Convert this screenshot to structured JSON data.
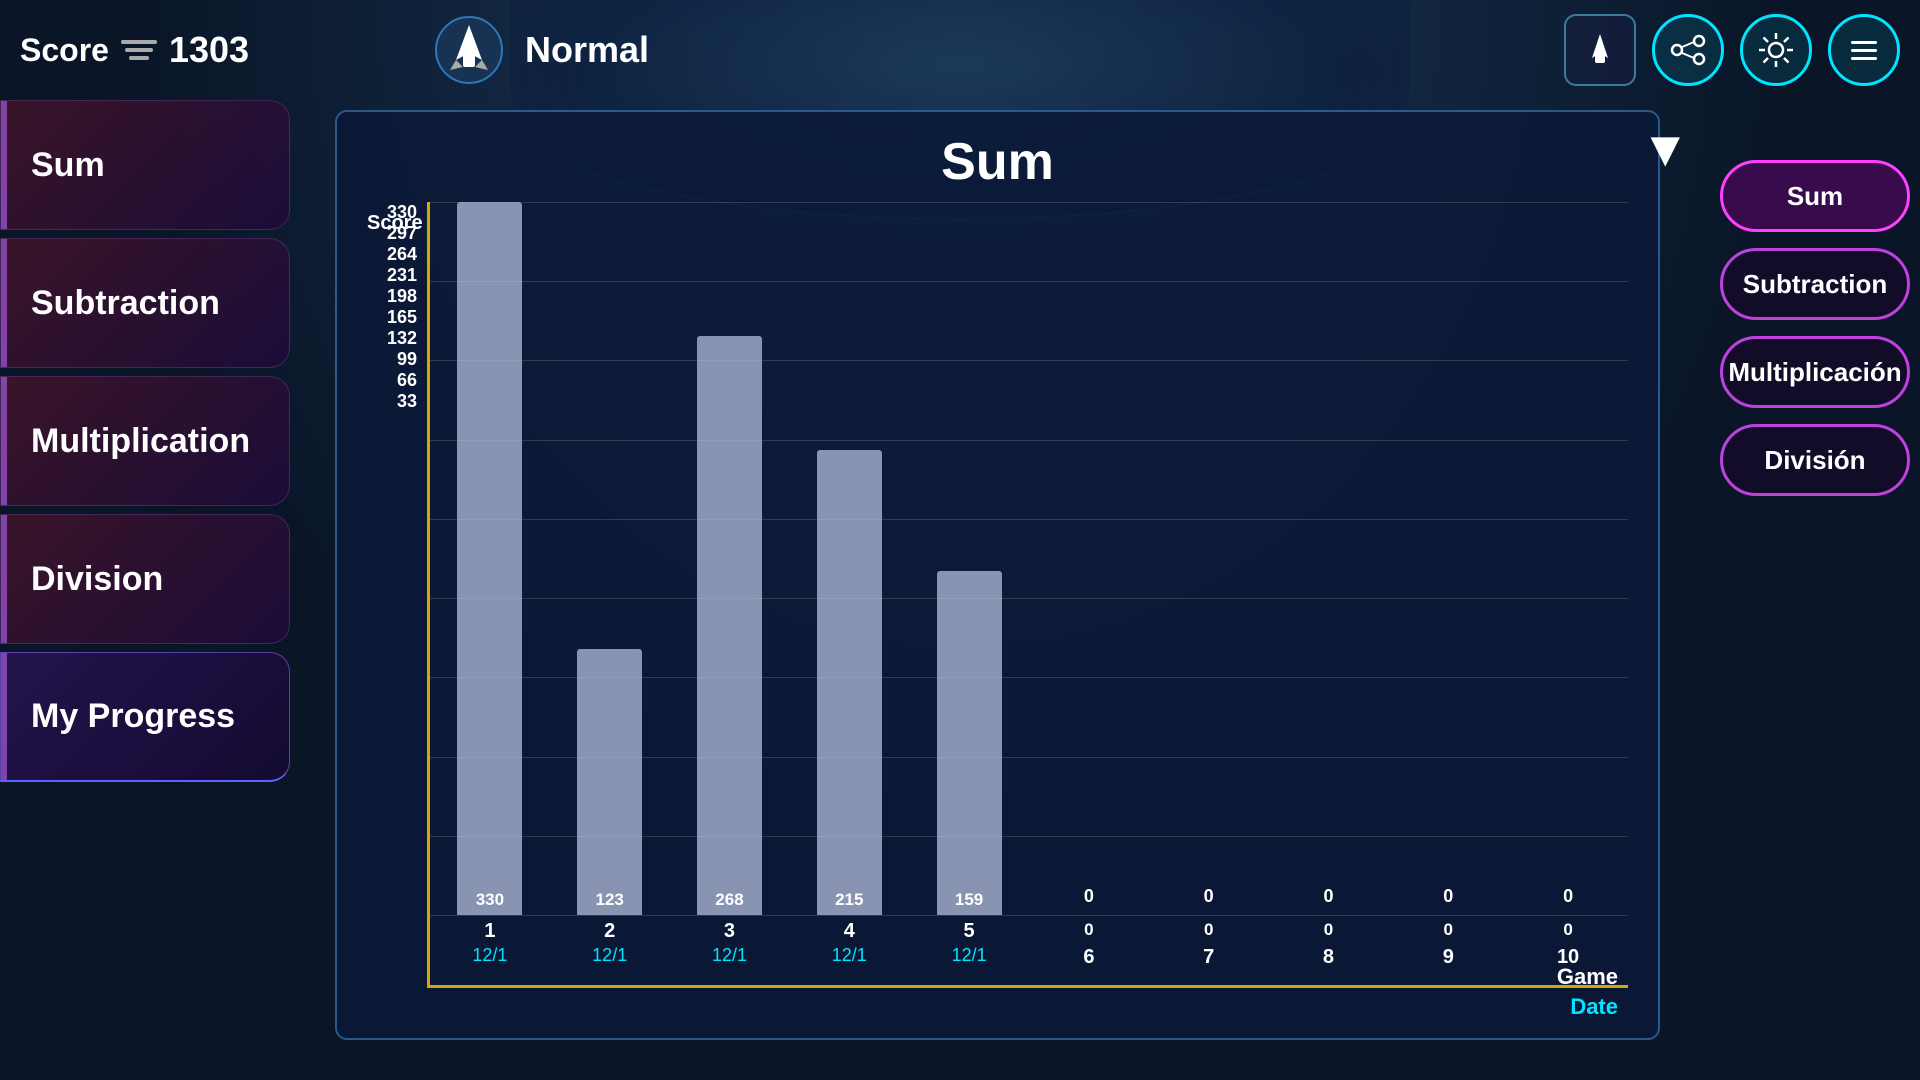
{
  "header": {
    "score_label": "Score",
    "score_value": "1303",
    "game_mode": "Normal"
  },
  "sidebar": {
    "items": [
      {
        "id": "sum",
        "label": "Sum",
        "active": false
      },
      {
        "id": "subtraction",
        "label": "Subtraction",
        "active": false
      },
      {
        "id": "multiplication",
        "label": "Multiplication",
        "active": false
      },
      {
        "id": "division",
        "label": "Division",
        "active": false
      },
      {
        "id": "my-progress",
        "label": "My Progress",
        "active": true
      }
    ]
  },
  "chart": {
    "title": "Sum",
    "y_axis_label": "Score",
    "x_axis_label": "Game",
    "date_label": "Date",
    "y_values": [
      "330",
      "297",
      "264",
      "231",
      "198",
      "165",
      "132",
      "99",
      "66",
      "33"
    ],
    "bars": [
      {
        "game": "1",
        "score": 330,
        "date": "12/1",
        "display": "330"
      },
      {
        "game": "2",
        "score": 123,
        "date": "12/1",
        "display": "123"
      },
      {
        "game": "3",
        "score": 268,
        "date": "12/1",
        "display": "268"
      },
      {
        "game": "4",
        "score": 215,
        "date": "12/1",
        "display": "215"
      },
      {
        "game": "5",
        "score": 159,
        "date": "12/1",
        "display": "159"
      },
      {
        "game": "6",
        "score": 0,
        "date": "",
        "display": "0"
      },
      {
        "game": "7",
        "score": 0,
        "date": "",
        "display": "0"
      },
      {
        "game": "8",
        "score": 0,
        "date": "",
        "display": "0"
      },
      {
        "game": "9",
        "score": 0,
        "date": "",
        "display": "0"
      },
      {
        "game": "10",
        "score": 0,
        "date": "",
        "display": "0"
      }
    ]
  },
  "right_panel": {
    "buttons": [
      {
        "id": "sum",
        "label": "Sum",
        "active": true
      },
      {
        "id": "subtraction",
        "label": "Subtraction",
        "active": false
      },
      {
        "id": "multiplicacion",
        "label": "Multiplicación",
        "active": false
      },
      {
        "id": "division",
        "label": "División",
        "active": false
      }
    ]
  }
}
